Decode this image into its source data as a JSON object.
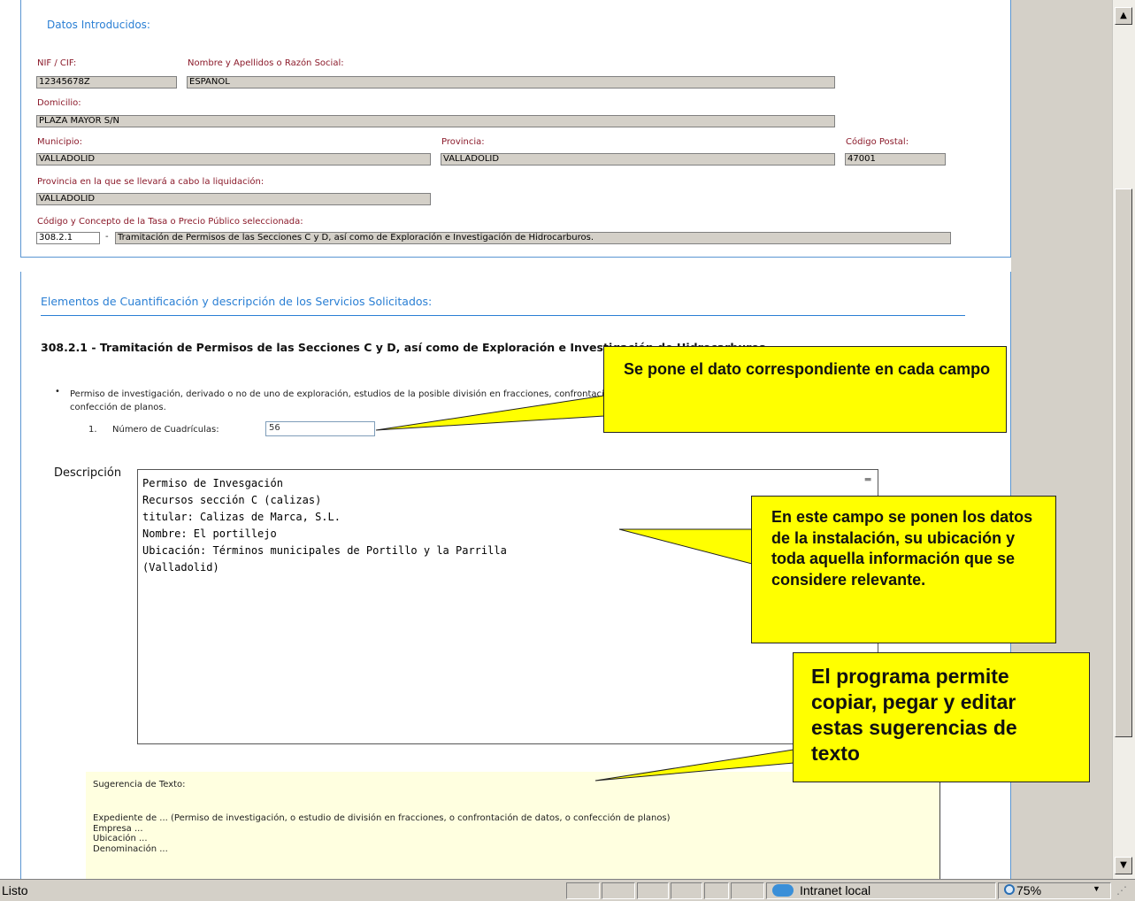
{
  "datos": {
    "section_title": "Datos Introducidos:",
    "nif_label": "NIF / CIF:",
    "nif_value": "12345678Z",
    "nombre_label": "Nombre y Apellidos o Razón Social:",
    "nombre_value": "ESPAÑOL",
    "domicilio_label": "Domicilio:",
    "domicilio_value": "PLAZA MAYOR S/N",
    "municipio_label": "Municipio:",
    "municipio_value": "VALLADOLID",
    "provincia_label": "Provincia:",
    "provincia_value": "VALLADOLID",
    "cp_label": "Código Postal:",
    "cp_value": "47001",
    "prov_liq_label": "Provincia en la que se llevará a cabo la liquidación:",
    "prov_liq_value": "VALLADOLID",
    "codigo_label": "Código y Concepto de la Tasa o Precio Público seleccionada:",
    "codigo_value": "308.2.1",
    "codigo_sep": "-",
    "concepto_value": "Tramitación de Permisos de las Secciones C y D, así como de Exploración e Investigación de Hidrocarburos."
  },
  "elementos": {
    "section_title": "Elementos de Cuantificación y descripción de los Servicios Solicitados:",
    "heading": "308.2.1 - Tramitación de Permisos de las Secciones C y D, así como de Exploración e Investigación de Hidrocarburos",
    "bullet_line1": "Permiso de investigación, derivado o no de uno de exploración, estudios de la posible división en fracciones, confrontación de datos, o",
    "bullet_line2": "confección de planos.",
    "item_number": "1.",
    "cuadriculas_label": "Número de Cuadrículas:",
    "cuadriculas_value": "56",
    "descripcion_label": "Descripción",
    "descripcion_lines": [
      "Permiso de Invesgación",
      "Recursos sección C (calizas)",
      "titular: Calizas de Marca, S.L.",
      "Nombre: El portillejo",
      "Ubicación: Términos municipales de Portillo y la Parrilla",
      "(Valladolid)"
    ],
    "sugerencia_title": "Sugerencia de Texto:",
    "sugerencia_lines": [
      "Expediente de ... (Permiso de investigación, o estudio de división en fracciones, o confrontación de datos, o confección de planos)",
      "Empresa ...",
      "Ubicación ...",
      "Denominación ..."
    ]
  },
  "callouts": {
    "c1": "Se pone el dato correspondiente en cada campo",
    "c2": "En este campo se ponen los datos de la instalación, su ubicación  y toda aquella información que se considere relevante.",
    "c3": "El programa permite copiar, pegar y editar estas sugerencias de texto"
  },
  "statusbar": {
    "status_text": "Listo",
    "zone_text": "Intranet local",
    "zoom_text": "75%"
  },
  "colors": {
    "accent": "#2a7fd4",
    "label": "#8b1a2a",
    "callout": "#ffff00",
    "field_bg": "#d4d0c8",
    "suggestion_bg": "#ffffe0"
  },
  "icons": {
    "scroll_up": "triangle-up-icon",
    "scroll_down": "triangle-down-icon",
    "zone": "globe-icon",
    "zoom": "magnifier-icon"
  }
}
